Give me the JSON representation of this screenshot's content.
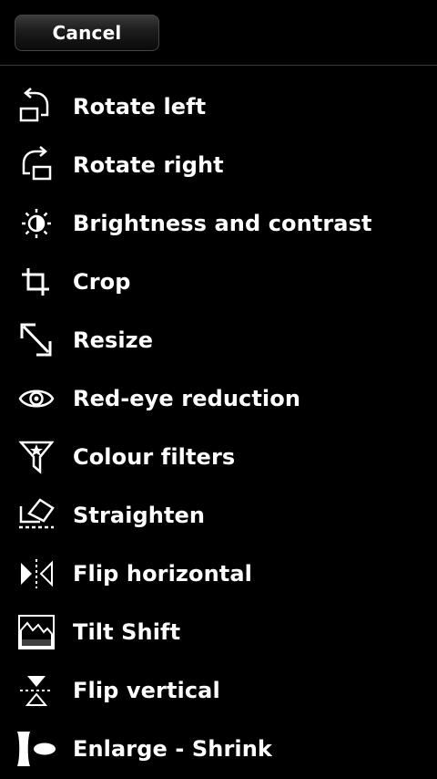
{
  "header": {
    "cancel_label": "Cancel"
  },
  "menu": {
    "items": [
      {
        "label": "Rotate left",
        "icon": "rotate-left-icon"
      },
      {
        "label": "Rotate right",
        "icon": "rotate-right-icon"
      },
      {
        "label": "Brightness and contrast",
        "icon": "brightness-icon"
      },
      {
        "label": "Crop",
        "icon": "crop-icon"
      },
      {
        "label": "Resize",
        "icon": "resize-icon"
      },
      {
        "label": "Red-eye reduction",
        "icon": "eye-icon"
      },
      {
        "label": "Colour filters",
        "icon": "colour-filter-icon"
      },
      {
        "label": "Straighten",
        "icon": "straighten-icon"
      },
      {
        "label": "Flip horizontal",
        "icon": "flip-horizontal-icon"
      },
      {
        "label": "Tilt Shift",
        "icon": "tilt-shift-icon"
      },
      {
        "label": "Flip vertical",
        "icon": "flip-vertical-icon"
      },
      {
        "label": "Enlarge - Shrink",
        "icon": "enlarge-shrink-icon"
      }
    ]
  },
  "colors": {
    "background": "#000000",
    "text": "#ffffff",
    "divider": "#3a3a3a"
  }
}
